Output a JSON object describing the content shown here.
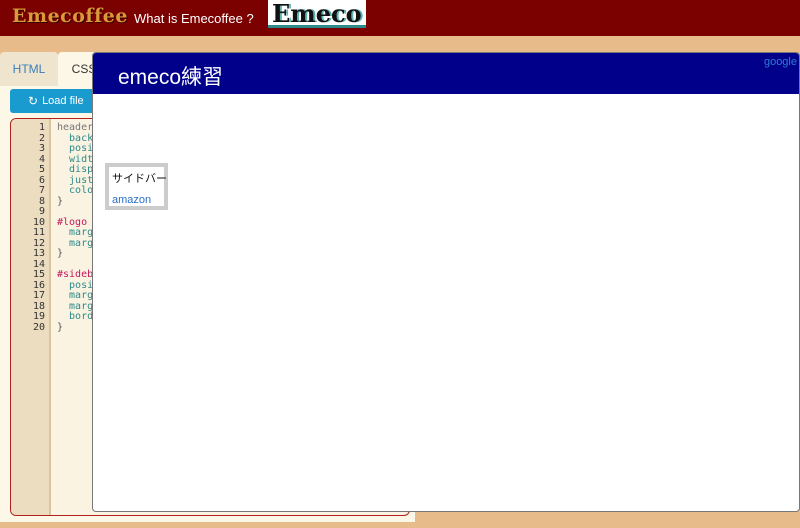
{
  "topbar": {
    "brand": "Emecoffee",
    "nav_link": "What is Emecoffee ?",
    "logo": "Emeco"
  },
  "editor": {
    "tabs": [
      {
        "label": "HTML",
        "active": false
      },
      {
        "label": "CSS",
        "active": true
      }
    ],
    "load_button": "Load file",
    "line_numbers": [
      "1",
      "2",
      "3",
      "4",
      "5",
      "6",
      "7",
      "8",
      "9",
      "10",
      "11",
      "12",
      "13",
      "14",
      "15",
      "16",
      "17",
      "18",
      "19",
      "20"
    ],
    "code_lines": [
      "header",
      "  back",
      "  posi",
      "  widt",
      "  disp",
      "  just",
      "  colo",
      "}",
      "",
      "#logo",
      "  marg",
      "  marg",
      "}",
      "",
      "#sideb",
      "  posi",
      "  marg",
      "  marg",
      "  bord",
      "}"
    ]
  },
  "preview": {
    "title": "emeco練習",
    "header_link": "google",
    "sidebar": {
      "title": "サイドバー",
      "link": "amazon"
    }
  },
  "colors": {
    "topbar": "#7b0000",
    "page_bg": "#e8bb8a",
    "preview_header": "#00008b",
    "load_button": "#1a9bd0"
  }
}
